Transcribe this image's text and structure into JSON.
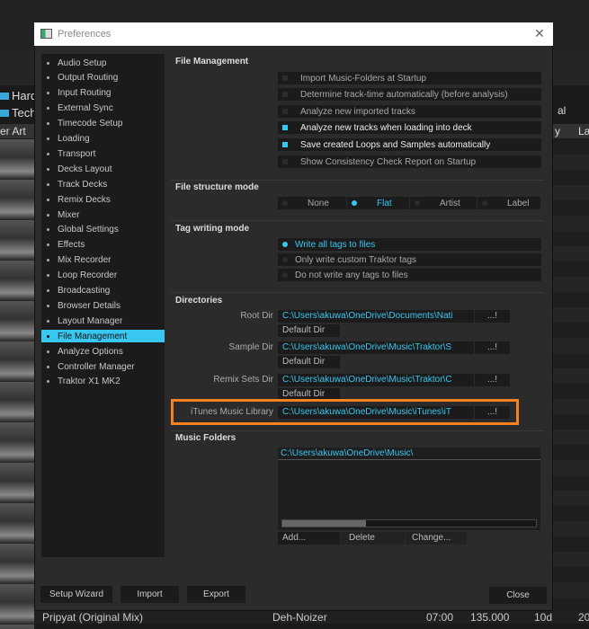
{
  "background": {
    "tree": [
      "Hard",
      "Tech"
    ],
    "column_header": "er Art",
    "right_header_1": "al",
    "right_header_2": "y",
    "right_header_3": "La",
    "track": {
      "title": "Pripyat (Original Mix)",
      "artist": "Deh-Noizer",
      "time": "07:00",
      "bpm": "135.000",
      "key": "10d",
      "date": "20"
    }
  },
  "dialog": {
    "title": "Preferences",
    "close_icon": "close-icon"
  },
  "sidebar": {
    "selected": "File Management",
    "items": [
      "Audio Setup",
      "Output Routing",
      "Input Routing",
      "External Sync",
      "Timecode Setup",
      "Loading",
      "Transport",
      "Decks Layout",
      "Track Decks",
      "Remix Decks",
      "Mixer",
      "Global Settings",
      "Effects",
      "Mix Recorder",
      "Loop Recorder",
      "Broadcasting",
      "Browser Details",
      "Layout Manager",
      "File Management",
      "Analyze Options",
      "Controller Manager",
      "Traktor X1 MK2"
    ]
  },
  "file_management": {
    "title": "File Management",
    "options": [
      {
        "label": "Import Music-Folders at Startup",
        "checked": false
      },
      {
        "label": "Determine track-time automatically (before analysis)",
        "checked": false
      },
      {
        "label": "Analyze new imported tracks",
        "checked": false
      },
      {
        "label": "Analyze new tracks when loading into deck",
        "checked": true
      },
      {
        "label": "Save created Loops and Samples automatically",
        "checked": true
      },
      {
        "label": "Show Consistency Check Report on Startup",
        "checked": false
      }
    ]
  },
  "file_structure": {
    "title": "File structure mode",
    "options": [
      "None",
      "Flat",
      "Artist",
      "Label"
    ],
    "selected": "Flat"
  },
  "tag_writing": {
    "title": "Tag writing mode",
    "options": [
      "Write all tags to files",
      "Only write custom Traktor tags",
      "Do not write any tags to files"
    ],
    "selected": "Write all tags to files"
  },
  "directories": {
    "title": "Directories",
    "browse_label": "...!",
    "default_label": "Default Dir",
    "items": [
      {
        "label": "Root Dir",
        "path": "C:\\Users\\akuwa\\OneDrive\\Documents\\Nati"
      },
      {
        "label": "Sample Dir",
        "path": "C:\\Users\\akuwa\\OneDrive\\Music\\Traktor\\S"
      },
      {
        "label": "Remix Sets Dir",
        "path": "C:\\Users\\akuwa\\OneDrive\\Music\\Traktor\\C"
      },
      {
        "label": "iTunes Music Library",
        "path": "C:\\Users\\akuwa\\OneDrive\\Music\\iTunes\\iT"
      }
    ],
    "highlight_color": "#f5821f"
  },
  "music_folders": {
    "title": "Music Folders",
    "folders": [
      "C:\\Users\\akuwa\\OneDrive\\Music\\"
    ],
    "add": "Add...",
    "delete": "Delete",
    "change": "Change..."
  },
  "footer": {
    "setup_wizard": "Setup Wizard",
    "import": "Import",
    "export": "Export",
    "close": "Close"
  },
  "accent": "#39c6f0"
}
